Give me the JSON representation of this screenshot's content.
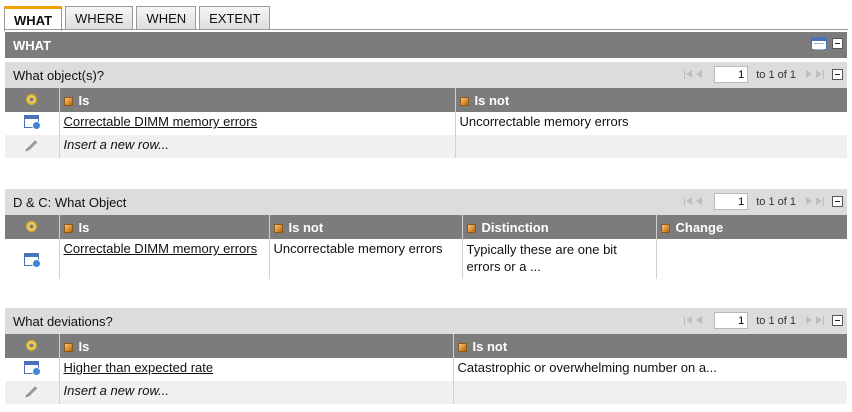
{
  "tabs": [
    {
      "label": "WHAT",
      "active": true
    },
    {
      "label": "WHERE",
      "active": false
    },
    {
      "label": "WHEN",
      "active": false
    },
    {
      "label": "EXTENT",
      "active": false
    }
  ],
  "main": {
    "title": "WHAT",
    "icons": [
      "spreadsheet-icon",
      "collapse-icon"
    ]
  },
  "sections": [
    {
      "title": "What object(s)?",
      "pager": {
        "page": "1",
        "text": "to 1 of 1"
      },
      "columns": [
        "Is",
        "Is not"
      ],
      "rows": [
        [
          "Correctable DIMM memory errors",
          "Uncorrectable memory errors"
        ]
      ],
      "insert_label": "Insert a new row..."
    },
    {
      "title": "D & C: What Object",
      "pager": {
        "page": "1",
        "text": "to 1 of 1"
      },
      "columns": [
        "Is",
        "Is not",
        "Distinction",
        "Change"
      ],
      "rows": [
        [
          "Correctable DIMM memory errors",
          "Uncorrectable memory errors",
          "Typically these are one bit errors or a ...",
          ""
        ]
      ]
    },
    {
      "title": "What deviations?",
      "pager": {
        "page": "1",
        "text": "to 1 of 1"
      },
      "columns": [
        "Is",
        "Is not"
      ],
      "rows": [
        [
          "Higher than expected rate",
          "Catastrophic or overwhelming number on a..."
        ]
      ],
      "insert_label": "Insert a new row..."
    }
  ]
}
